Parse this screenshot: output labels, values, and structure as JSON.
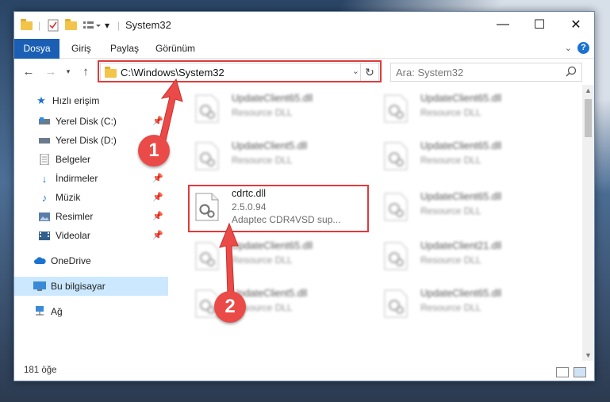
{
  "window": {
    "title": "System32"
  },
  "ribbon": {
    "tabs": [
      "Dosya",
      "Giriş",
      "Paylaş",
      "Görünüm"
    ]
  },
  "nav": {
    "path": "C:\\Windows\\System32",
    "search_placeholder": "Ara: System32"
  },
  "sidebar": {
    "items": [
      {
        "label": "Hızlı erişim",
        "icon": "star-icon"
      },
      {
        "label": "Yerel Disk (C:)",
        "icon": "drive-icon"
      },
      {
        "label": "Yerel Disk (D:)",
        "icon": "drive-icon"
      },
      {
        "label": "Belgeler",
        "icon": "document-icon"
      },
      {
        "label": "İndirmeler",
        "icon": "download-icon"
      },
      {
        "label": "Müzik",
        "icon": "music-icon"
      },
      {
        "label": "Resimler",
        "icon": "pictures-icon"
      },
      {
        "label": "Videolar",
        "icon": "video-icon"
      },
      {
        "label": "OneDrive",
        "icon": "cloud-icon"
      },
      {
        "label": "Bu bilgisayar",
        "icon": "computer-icon"
      },
      {
        "label": "Ağ",
        "icon": "network-icon"
      }
    ]
  },
  "files": [
    {
      "name": "UpdateClient65.dll",
      "type": "Resource DLL"
    },
    {
      "name": "UpdateClient65.dll",
      "type": "Resource DLL"
    },
    {
      "name": "UpdateClient5.dll",
      "type": "Resource DLL"
    },
    {
      "name": "UpdateClient65.dll",
      "type": "Resource DLL"
    },
    {
      "name": "cdrtc.dll",
      "version": "2.5.0.94",
      "description": "Adaptec CDR4VSD sup..."
    },
    {
      "name": "UpdateClient65.dll",
      "type": "Resource DLL"
    },
    {
      "name": "UpdateClient65.dll",
      "type": "Resource DLL"
    },
    {
      "name": "UpdateClient21.dll",
      "type": "Resource DLL"
    },
    {
      "name": "UpdateClient5.dll",
      "type": "Resource DLL"
    },
    {
      "name": "UpdateClient65.dll",
      "type": "Resource DLL"
    }
  ],
  "status": {
    "count": "181 öğe"
  },
  "annotations": {
    "step1": "1",
    "step2": "2"
  },
  "colors": {
    "accent": "#1a5fb4",
    "highlight": "#e03a3a",
    "selected": "#cce8ff"
  }
}
